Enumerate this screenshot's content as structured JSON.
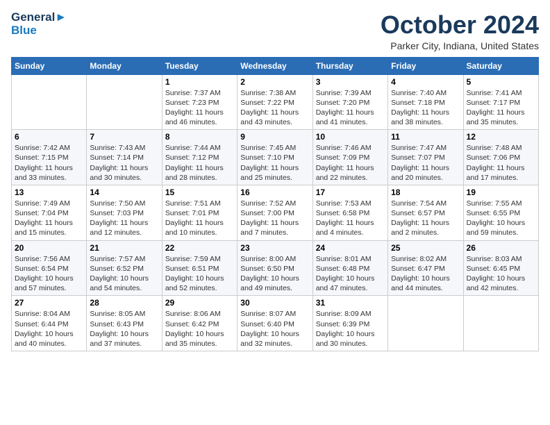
{
  "header": {
    "logo_line1": "General",
    "logo_line2": "Blue",
    "month_title": "October 2024",
    "location": "Parker City, Indiana, United States"
  },
  "weekdays": [
    "Sunday",
    "Monday",
    "Tuesday",
    "Wednesday",
    "Thursday",
    "Friday",
    "Saturday"
  ],
  "weeks": [
    [
      {
        "day": "",
        "info": ""
      },
      {
        "day": "",
        "info": ""
      },
      {
        "day": "1",
        "info": "Sunrise: 7:37 AM\nSunset: 7:23 PM\nDaylight: 11 hours and 46 minutes."
      },
      {
        "day": "2",
        "info": "Sunrise: 7:38 AM\nSunset: 7:22 PM\nDaylight: 11 hours and 43 minutes."
      },
      {
        "day": "3",
        "info": "Sunrise: 7:39 AM\nSunset: 7:20 PM\nDaylight: 11 hours and 41 minutes."
      },
      {
        "day": "4",
        "info": "Sunrise: 7:40 AM\nSunset: 7:18 PM\nDaylight: 11 hours and 38 minutes."
      },
      {
        "day": "5",
        "info": "Sunrise: 7:41 AM\nSunset: 7:17 PM\nDaylight: 11 hours and 35 minutes."
      }
    ],
    [
      {
        "day": "6",
        "info": "Sunrise: 7:42 AM\nSunset: 7:15 PM\nDaylight: 11 hours and 33 minutes."
      },
      {
        "day": "7",
        "info": "Sunrise: 7:43 AM\nSunset: 7:14 PM\nDaylight: 11 hours and 30 minutes."
      },
      {
        "day": "8",
        "info": "Sunrise: 7:44 AM\nSunset: 7:12 PM\nDaylight: 11 hours and 28 minutes."
      },
      {
        "day": "9",
        "info": "Sunrise: 7:45 AM\nSunset: 7:10 PM\nDaylight: 11 hours and 25 minutes."
      },
      {
        "day": "10",
        "info": "Sunrise: 7:46 AM\nSunset: 7:09 PM\nDaylight: 11 hours and 22 minutes."
      },
      {
        "day": "11",
        "info": "Sunrise: 7:47 AM\nSunset: 7:07 PM\nDaylight: 11 hours and 20 minutes."
      },
      {
        "day": "12",
        "info": "Sunrise: 7:48 AM\nSunset: 7:06 PM\nDaylight: 11 hours and 17 minutes."
      }
    ],
    [
      {
        "day": "13",
        "info": "Sunrise: 7:49 AM\nSunset: 7:04 PM\nDaylight: 11 hours and 15 minutes."
      },
      {
        "day": "14",
        "info": "Sunrise: 7:50 AM\nSunset: 7:03 PM\nDaylight: 11 hours and 12 minutes."
      },
      {
        "day": "15",
        "info": "Sunrise: 7:51 AM\nSunset: 7:01 PM\nDaylight: 11 hours and 10 minutes."
      },
      {
        "day": "16",
        "info": "Sunrise: 7:52 AM\nSunset: 7:00 PM\nDaylight: 11 hours and 7 minutes."
      },
      {
        "day": "17",
        "info": "Sunrise: 7:53 AM\nSunset: 6:58 PM\nDaylight: 11 hours and 4 minutes."
      },
      {
        "day": "18",
        "info": "Sunrise: 7:54 AM\nSunset: 6:57 PM\nDaylight: 11 hours and 2 minutes."
      },
      {
        "day": "19",
        "info": "Sunrise: 7:55 AM\nSunset: 6:55 PM\nDaylight: 10 hours and 59 minutes."
      }
    ],
    [
      {
        "day": "20",
        "info": "Sunrise: 7:56 AM\nSunset: 6:54 PM\nDaylight: 10 hours and 57 minutes."
      },
      {
        "day": "21",
        "info": "Sunrise: 7:57 AM\nSunset: 6:52 PM\nDaylight: 10 hours and 54 minutes."
      },
      {
        "day": "22",
        "info": "Sunrise: 7:59 AM\nSunset: 6:51 PM\nDaylight: 10 hours and 52 minutes."
      },
      {
        "day": "23",
        "info": "Sunrise: 8:00 AM\nSunset: 6:50 PM\nDaylight: 10 hours and 49 minutes."
      },
      {
        "day": "24",
        "info": "Sunrise: 8:01 AM\nSunset: 6:48 PM\nDaylight: 10 hours and 47 minutes."
      },
      {
        "day": "25",
        "info": "Sunrise: 8:02 AM\nSunset: 6:47 PM\nDaylight: 10 hours and 44 minutes."
      },
      {
        "day": "26",
        "info": "Sunrise: 8:03 AM\nSunset: 6:45 PM\nDaylight: 10 hours and 42 minutes."
      }
    ],
    [
      {
        "day": "27",
        "info": "Sunrise: 8:04 AM\nSunset: 6:44 PM\nDaylight: 10 hours and 40 minutes."
      },
      {
        "day": "28",
        "info": "Sunrise: 8:05 AM\nSunset: 6:43 PM\nDaylight: 10 hours and 37 minutes."
      },
      {
        "day": "29",
        "info": "Sunrise: 8:06 AM\nSunset: 6:42 PM\nDaylight: 10 hours and 35 minutes."
      },
      {
        "day": "30",
        "info": "Sunrise: 8:07 AM\nSunset: 6:40 PM\nDaylight: 10 hours and 32 minutes."
      },
      {
        "day": "31",
        "info": "Sunrise: 8:09 AM\nSunset: 6:39 PM\nDaylight: 10 hours and 30 minutes."
      },
      {
        "day": "",
        "info": ""
      },
      {
        "day": "",
        "info": ""
      }
    ]
  ]
}
